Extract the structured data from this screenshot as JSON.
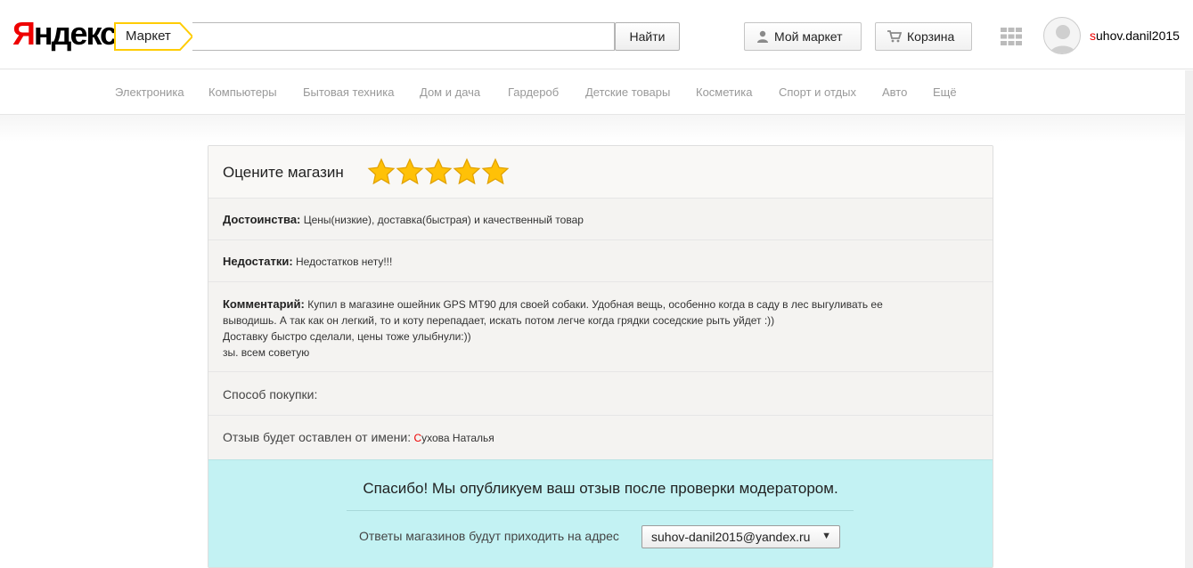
{
  "header": {
    "logo": {
      "first_letter": "Я",
      "rest": "ндекс"
    },
    "search_tab_label": "Маркет",
    "search_value": "",
    "search_button": "Найти",
    "my_market_button": "Мой маркет",
    "cart_button": "Корзина",
    "user": {
      "first_letter": "s",
      "rest": "uhov.danil2015"
    }
  },
  "nav": {
    "items": [
      "Электроника",
      "Компьютеры",
      "Бытовая техника",
      "Дом и дача",
      "Гардероб",
      "Детские товары",
      "Косметика",
      "Спорт и отдых",
      "Авто",
      "Ещё"
    ]
  },
  "review": {
    "rate_label": "Оцените магазин",
    "rating": 5,
    "rating_max": 5,
    "pros_label": "Достоинства:",
    "pros_text": "Цены(низкие), доставка(быстрая) и качественный товар",
    "cons_label": "Недостатки:",
    "cons_text": "Недостатков нету!!!",
    "comment_label": "Комментарий:",
    "comment_lines": [
      "Купил в магазине ошейник GPS MT90 для своей собаки. Удобная вещь, особенно когда в саду в лес выгуливать ее",
      "выводишь. А так как он легкий, то и коту перепадает, искать потом легче когда грядки соседские рыть уйдет :))",
      "Доставку быстро сделали, цены тоже улыбнули:))",
      "зы. всем советую"
    ],
    "method_label": "Способ покупки:",
    "author_label": "Отзыв будет оставлен от имени:",
    "author_name": {
      "first_letter": "С",
      "rest": "ухова Наталья"
    }
  },
  "thanks": {
    "title": "Спасибо! Мы опубликуем ваш отзыв после проверки модератором.",
    "address_label": "Ответы магазинов будут приходить на адрес",
    "email": "suhov-danil2015@yandex.ru"
  },
  "colors": {
    "brand_red": "#ee0000",
    "search_yellow": "#ffcc00",
    "star_fill": "#ffc107",
    "thanks_bg": "#c3f2f3"
  },
  "icons": {
    "my_market": "user-icon",
    "cart": "cart-icon",
    "apps": "apps-grid-icon",
    "avatar": "avatar-icon",
    "star": "star-icon",
    "dropdown": "dropdown-arrow-icon"
  }
}
